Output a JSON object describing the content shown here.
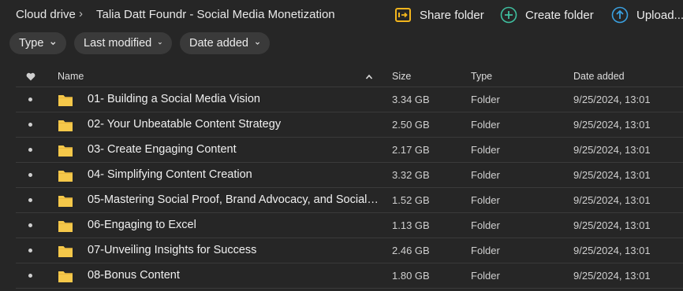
{
  "breadcrumb": {
    "root": "Cloud drive",
    "current": "Talia Datt Foundr - Social Media Monetization"
  },
  "actions": {
    "share_folder": "Share folder",
    "create_folder": "Create folder",
    "upload": "Upload..."
  },
  "filters": {
    "type": "Type",
    "last_modified": "Last modified",
    "date_added": "Date added"
  },
  "table": {
    "headers": {
      "name": "Name",
      "size": "Size",
      "type": "Type",
      "date_added": "Date added"
    },
    "rows": [
      {
        "name": "01- Building a Social Media Vision",
        "size": "3.34 GB",
        "type": "Folder",
        "date": "9/25/2024, 13:01"
      },
      {
        "name": "02- Your Unbeatable Content Strategy",
        "size": "2.50 GB",
        "type": "Folder",
        "date": "9/25/2024, 13:01"
      },
      {
        "name": "03- Create Engaging Content",
        "size": "2.17 GB",
        "type": "Folder",
        "date": "9/25/2024, 13:01"
      },
      {
        "name": "04- Simplifying Content Creation",
        "size": "3.32 GB",
        "type": "Folder",
        "date": "9/25/2024, 13:01"
      },
      {
        "name": "05-Mastering Social Proof, Brand Advocacy, and Social Sel...",
        "size": "1.52 GB",
        "type": "Folder",
        "date": "9/25/2024, 13:01"
      },
      {
        "name": "06-Engaging to Excel",
        "size": "1.13 GB",
        "type": "Folder",
        "date": "9/25/2024, 13:01"
      },
      {
        "name": "07-Unveiling Insights for Success",
        "size": "2.46 GB",
        "type": "Folder",
        "date": "9/25/2024, 13:01"
      },
      {
        "name": "08-Bonus Content",
        "size": "1.80 GB",
        "type": "Folder",
        "date": "9/25/2024, 13:01"
      }
    ]
  },
  "icons": {
    "share": "share-folder-icon",
    "create": "create-folder-icon",
    "upload": "upload-icon",
    "favourite": "heart-icon",
    "sort": "sort-ascending-icon",
    "folder": "folder-icon"
  },
  "colors": {
    "background": "#262626",
    "share_accent": "#f2b51d",
    "create_accent": "#3fbf9f",
    "upload_accent": "#3aa0e0",
    "folder": "#f5c84a"
  }
}
